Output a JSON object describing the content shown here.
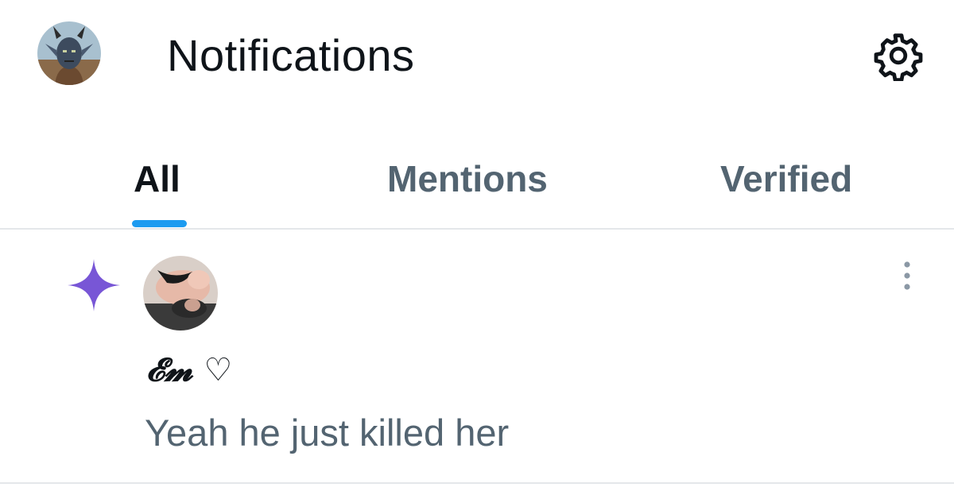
{
  "header": {
    "title": "Notifications",
    "avatar_icon": "horned-character-avatar",
    "settings_icon": "gear-icon"
  },
  "tabs": [
    {
      "label": "All",
      "active": true
    },
    {
      "label": "Mentions",
      "active": false
    },
    {
      "label": "Verified",
      "active": false
    }
  ],
  "colors": {
    "accent": "#1d9bf0",
    "sparkle": "#7856d6",
    "primary_text": "#0f1419",
    "secondary_text": "#536471",
    "divider": "#e4e7ea"
  },
  "notifications": [
    {
      "type_icon": "sparkle-icon",
      "user_avatar": "user-photo-avatar",
      "username": "𝓔𝓶 ♡",
      "text": "Yeah he just killed her",
      "more_icon": "more-vertical-icon"
    }
  ]
}
